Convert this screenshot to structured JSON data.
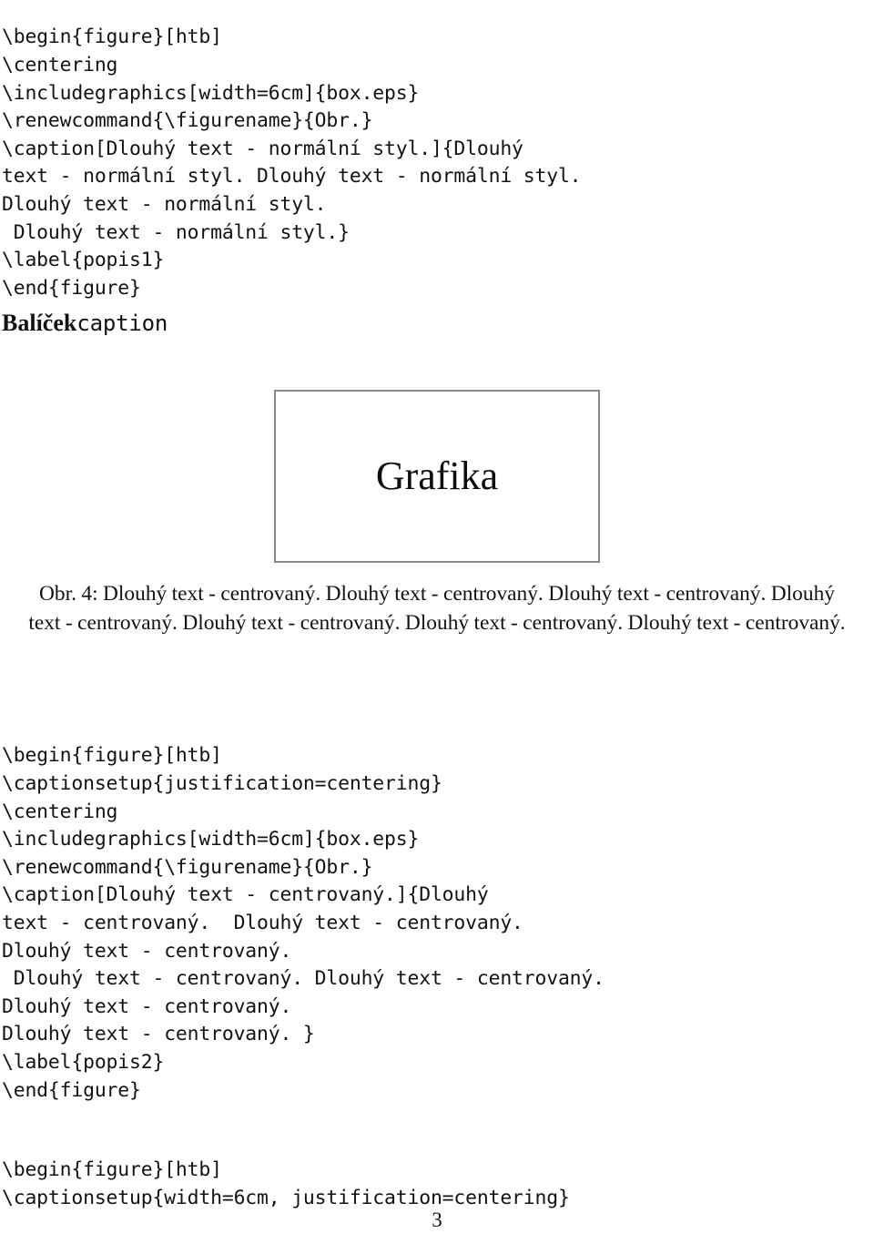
{
  "document": {
    "page_number": "3",
    "language": "cs"
  },
  "code_block_1": {
    "lines": [
      "\\begin{figure}[htb]",
      "\\centering",
      "\\includegraphics[width=6cm]{box.eps}",
      "\\renewcommand{\\figurename}{Obr.}",
      "\\caption[Dlouhý text - normální styl.]{Dlouhý",
      "text - normální styl. Dlouhý text - normální styl.",
      "Dlouhý text - normální styl.",
      " Dlouhý text - normální styl.}",
      "\\label{popis1}",
      "\\end{figure}"
    ]
  },
  "section": {
    "heading_bold": "Balíček",
    "heading_mono": "caption"
  },
  "figure_1": {
    "box_label": "Grafika",
    "caption": "Obr. 4: Dlouhý text - centrovaný. Dlouhý text - centrovaný. Dlouhý text - centrovaný. Dlouhý text - centrovaný. Dlouhý text - centrovaný. Dlouhý text - centrovaný. Dlouhý text - centrovaný."
  },
  "code_block_2": {
    "lines": [
      "\\begin{figure}[htb]",
      "\\captionsetup{justification=centering}",
      "\\centering",
      "\\includegraphics[width=6cm]{box.eps}",
      "\\renewcommand{\\figurename}{Obr.}",
      "\\caption[Dlouhý text - centrovaný.]{Dlouhý",
      "text - centrovaný.  Dlouhý text - centrovaný.",
      "Dlouhý text - centrovaný.",
      " Dlouhý text - centrovaný. Dlouhý text - centrovaný.",
      "Dlouhý text - centrovaný.",
      "Dlouhý text - centrovaný. }",
      "\\label{popis2}",
      "\\end{figure}"
    ]
  },
  "code_block_3": {
    "lines": [
      "\\begin{figure}[htb]",
      "\\captionsetup{width=6cm, justification=centering}"
    ]
  },
  "colors": {
    "text": "#121212",
    "box_border": "#8a8a8a",
    "background": "#ffffff"
  }
}
